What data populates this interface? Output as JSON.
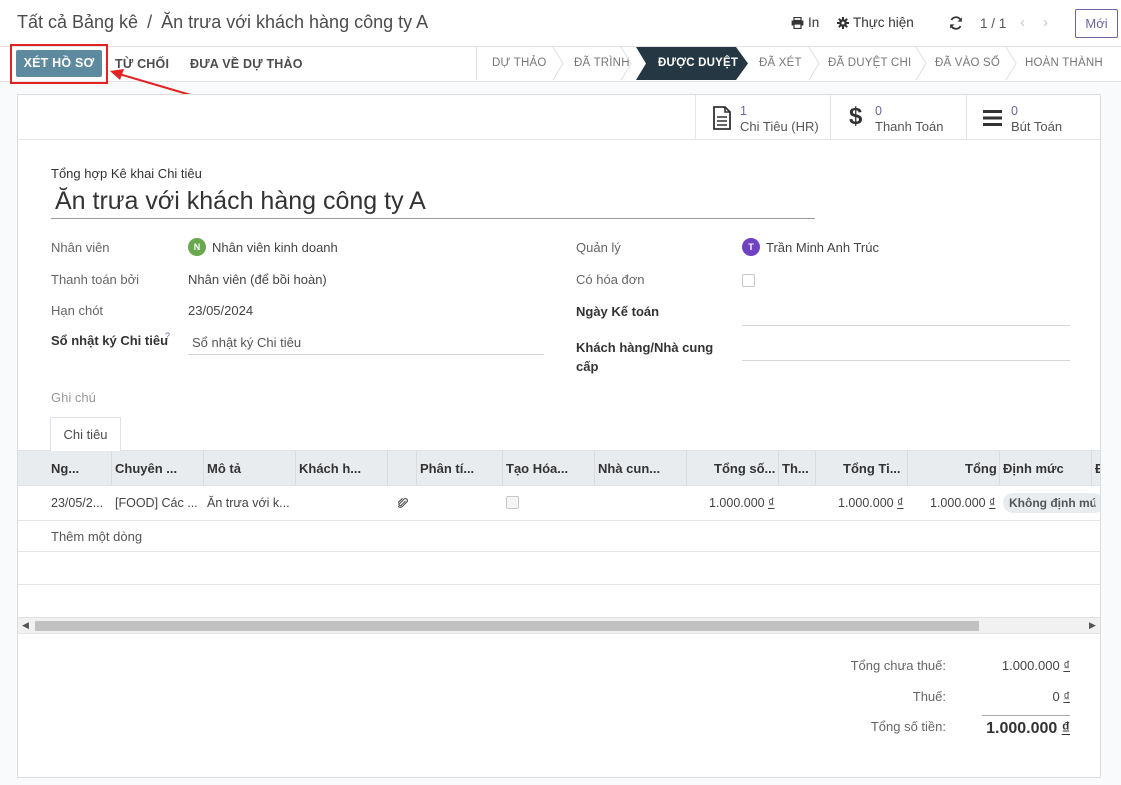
{
  "breadcrumb": {
    "parent": "Tất cả Bảng kê",
    "separator": "/",
    "current": "Ăn trưa với khách hàng công ty A"
  },
  "control": {
    "print_label": "In",
    "action_label": "Thực hiện",
    "pager": "1 / 1",
    "new_label": "Mới"
  },
  "buttons": {
    "approve": "XÉT HỒ SƠ",
    "refuse": "TỪ CHỐI",
    "reset": "ĐƯA VỀ DỰ THẢO"
  },
  "stages": [
    "DỰ THẢO",
    "ĐÃ TRÌNH",
    "ĐƯỢC DUYỆT",
    "ĐÃ XÉT",
    "ĐÃ DUYỆT CHI",
    "ĐÃ VÀO SỔ",
    "HOÀN THÀNH"
  ],
  "active_stage": "ĐƯỢC DUYỆT",
  "smart_buttons": [
    {
      "count": "1",
      "label": "Chi Tiêu (HR)",
      "icon": "document-icon"
    },
    {
      "count": "0",
      "label": "Thanh Toán",
      "icon": "dollar-icon"
    },
    {
      "count": "0",
      "label": "Bút Toán",
      "icon": "bars-icon"
    }
  ],
  "form": {
    "subtitle": "Tổng hợp Kê khai Chi tiêu",
    "title": "Ăn trưa với khách hàng công ty A",
    "employee_label": "Nhân viên",
    "employee": "Nhân viên kinh doanh",
    "employee_initial": "N",
    "paid_by_label": "Thanh toán bởi",
    "paid_by": "Nhân viên (để bồi hoàn)",
    "deadline_label": "Hạn chót",
    "deadline": "23/05/2024",
    "journal_label": "Sổ nhật ký Chi tiêu",
    "journal_help": "?",
    "journal_placeholder": "Sổ nhật ký Chi tiêu",
    "manager_label": "Quản lý",
    "manager": "Trần Minh Anh Trúc",
    "manager_initial": "T",
    "invoice_label": "Có hóa đơn",
    "acc_date_label": "Ngày Kế toán",
    "partner_label_1": "Khách hàng/Nhà cung",
    "partner_label_2": "cấp",
    "notes_label": "Ghi chú"
  },
  "tab": {
    "label": "Chi tiêu"
  },
  "table": {
    "headers": [
      "Ng...",
      "Chuyên ...",
      "Mô tả",
      "Khách h...",
      "Phân tí...",
      "Tạo Hóa...",
      "Nhà cun...",
      "Tổng số...",
      "Th...",
      "Tổng Ti...",
      "Tổng",
      "Định mức",
      "Đ"
    ],
    "row": {
      "date": "23/05/2...",
      "category": "[FOOD] Các ...",
      "description": "Ăn trưa với k...",
      "untaxed": "1.000.000",
      "currency": "₫",
      "total_currency": "1.000.000",
      "total": "1.000.000",
      "norm": "Không định mứ"
    },
    "add_line": "Thêm một dòng"
  },
  "totals": {
    "untaxed_label": "Tổng chưa thuế:",
    "untaxed": "1.000.000",
    "tax_label": "Thuế:",
    "tax": "0",
    "total_label": "Tổng số tiền:",
    "total": "1.000.000",
    "currency": "₫"
  },
  "colors": {
    "primary": "#5e8aa0",
    "active_stage": "#243742",
    "brand": "#71639e",
    "annotation": "#e32222"
  }
}
